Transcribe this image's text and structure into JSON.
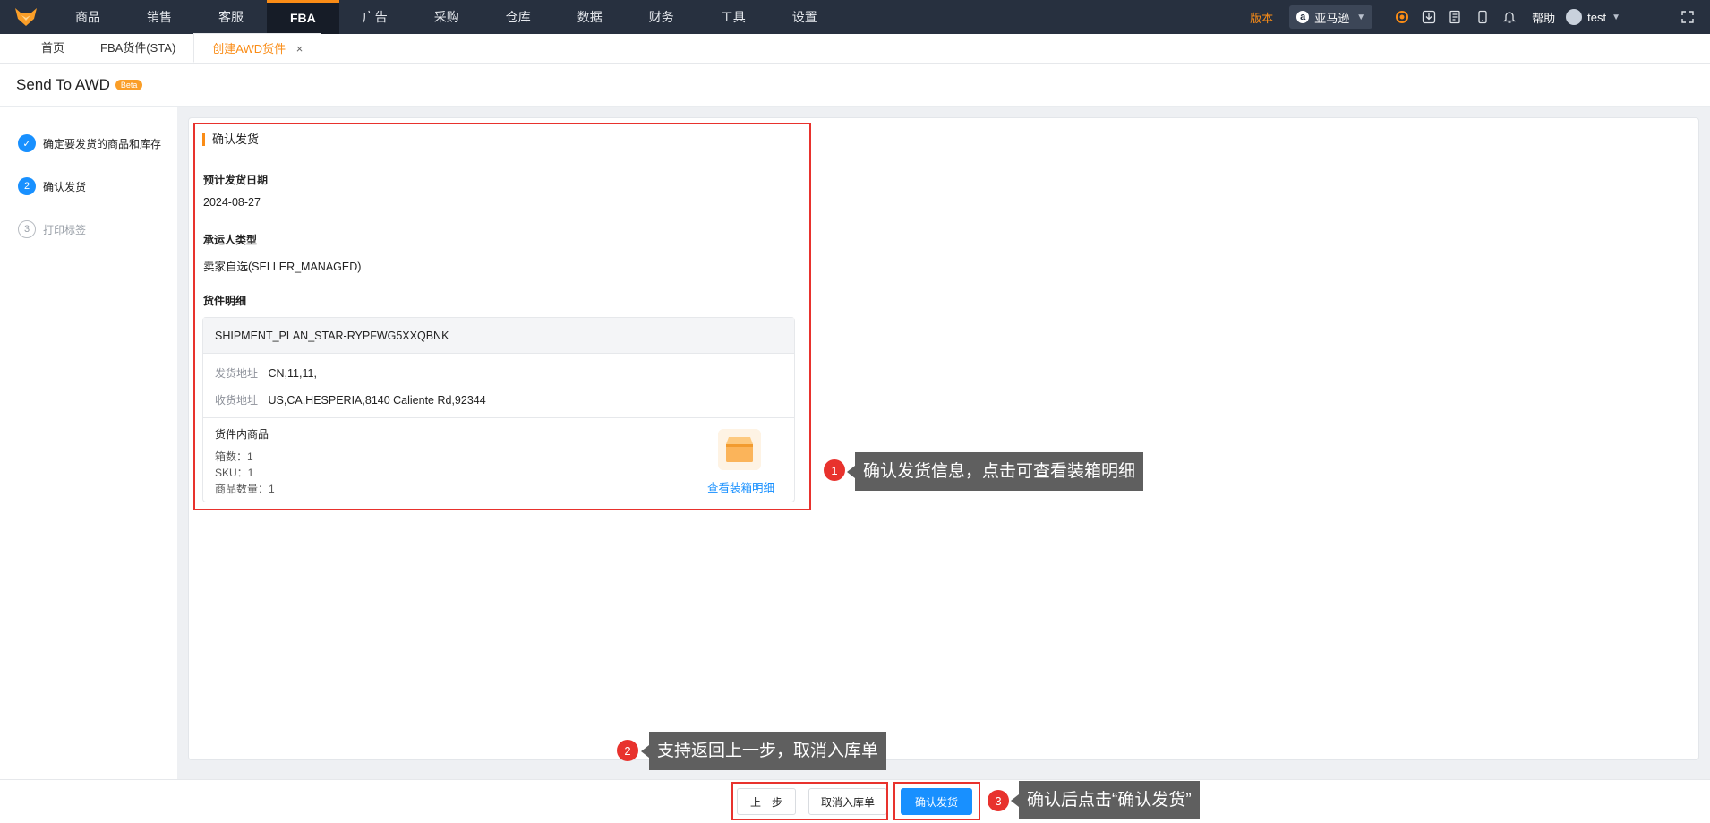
{
  "nav": {
    "items": [
      "商品",
      "销售",
      "客服",
      "FBA",
      "广告",
      "采购",
      "仓库",
      "数据",
      "财务",
      "工具",
      "设置"
    ],
    "active": "FBA",
    "version_label": "版本",
    "marketplace": "亚马逊",
    "help_label": "帮助",
    "user_name": "test"
  },
  "tabs": [
    {
      "label": "首页"
    },
    {
      "label": "FBA货件(STA)"
    },
    {
      "label": "创建AWD货件",
      "close": "×"
    }
  ],
  "page": {
    "title": "Send To AWD",
    "badge": "Beta"
  },
  "steps": [
    {
      "num": "✓",
      "label": "确定要发货的商品和库存",
      "state": "done"
    },
    {
      "num": "2",
      "label": "确认发货",
      "state": "current"
    },
    {
      "num": "3",
      "label": "打印标签",
      "state": "todo"
    }
  ],
  "confirm": {
    "section_title": "确认发货",
    "ship_date_label": "预计发货日期",
    "ship_date": "2024-08-27",
    "carrier_label": "承运人类型",
    "carrier": "卖家自选(SELLER_MANAGED)",
    "detail_label": "货件明细",
    "shipment_id": "SHIPMENT_PLAN_STAR-RYPFWG5XXQBNK",
    "from_label": "发货地址",
    "from_value": "CN,11,11,",
    "to_label": "收货地址",
    "to_value": "US,CA,HESPERIA,8140 Caliente Rd,92344",
    "goods_title": "货件内商品",
    "boxes": "箱数：1",
    "sku": "SKU：1",
    "qty": "商品数量：1",
    "view_box_link": "查看装箱明细"
  },
  "annotations": {
    "c1_num": "1",
    "c1_text": "确认发货信息，点击可查看装箱明细",
    "c2_num": "2",
    "c2_text": "支持返回上一步，取消入库单",
    "c3_num": "3",
    "c3_text": "确认后点击“确认发货”"
  },
  "footer": {
    "prev_label": "上一步",
    "cancel_label": "取消入库单",
    "confirm_label": "确认发货"
  },
  "colors": {
    "nav_bg": "#27303f",
    "accent": "#fa8c16",
    "primary": "#1890ff",
    "annotation_red": "#e8322d",
    "callout_bg": "#5f5f5f"
  }
}
